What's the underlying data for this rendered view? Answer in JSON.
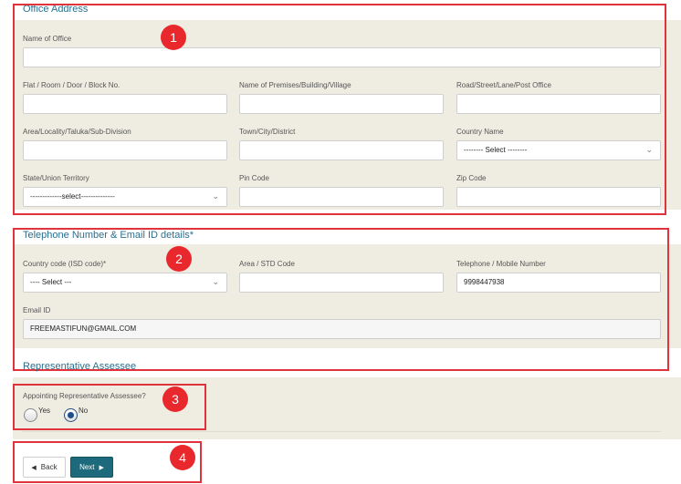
{
  "office_address": {
    "title": "Office Address",
    "name_of_office": {
      "label": "Name of Office",
      "value": ""
    },
    "flat_room": {
      "label": "Flat / Room / Door / Block No.",
      "value": ""
    },
    "premises": {
      "label": "Name of Premises/Building/Village",
      "value": ""
    },
    "road": {
      "label": "Road/Street/Lane/Post Office",
      "value": ""
    },
    "area": {
      "label": "Area/Locality/Taluka/Sub-Division",
      "value": ""
    },
    "town": {
      "label": "Town/City/District",
      "value": ""
    },
    "country": {
      "label": "Country Name",
      "selected": "-------- Select --------"
    },
    "state": {
      "label": "State/Union Territory",
      "selected": "-------------select--------------"
    },
    "pin": {
      "label": "Pin Code",
      "value": ""
    },
    "zip": {
      "label": "Zip Code",
      "value": ""
    }
  },
  "telephone": {
    "title": "Telephone Number & Email ID details*",
    "country_code": {
      "label": "Country code (ISD code)*",
      "selected": "---- Select ---"
    },
    "area_std": {
      "label": "Area / STD Code",
      "value": ""
    },
    "mobile": {
      "label": "Telephone / Mobile Number",
      "value": "9998447938"
    },
    "email": {
      "label": "Email ID",
      "value": "FREEMASTIFUN@GMAIL.COM"
    }
  },
  "representative": {
    "title": "Representative Assessee",
    "question": "Appointing Representative Assessee?",
    "options": [
      {
        "label": "Yes",
        "selected": false
      },
      {
        "label": "No",
        "selected": true
      }
    ]
  },
  "buttons": {
    "back": "Back",
    "next": "Next"
  },
  "annotations": [
    "1",
    "2",
    "3",
    "4"
  ],
  "colors": {
    "accent": "#1c6a7c",
    "title": "#2a6f8f",
    "annotation_red": "#e0333b",
    "band": "#efede2"
  }
}
